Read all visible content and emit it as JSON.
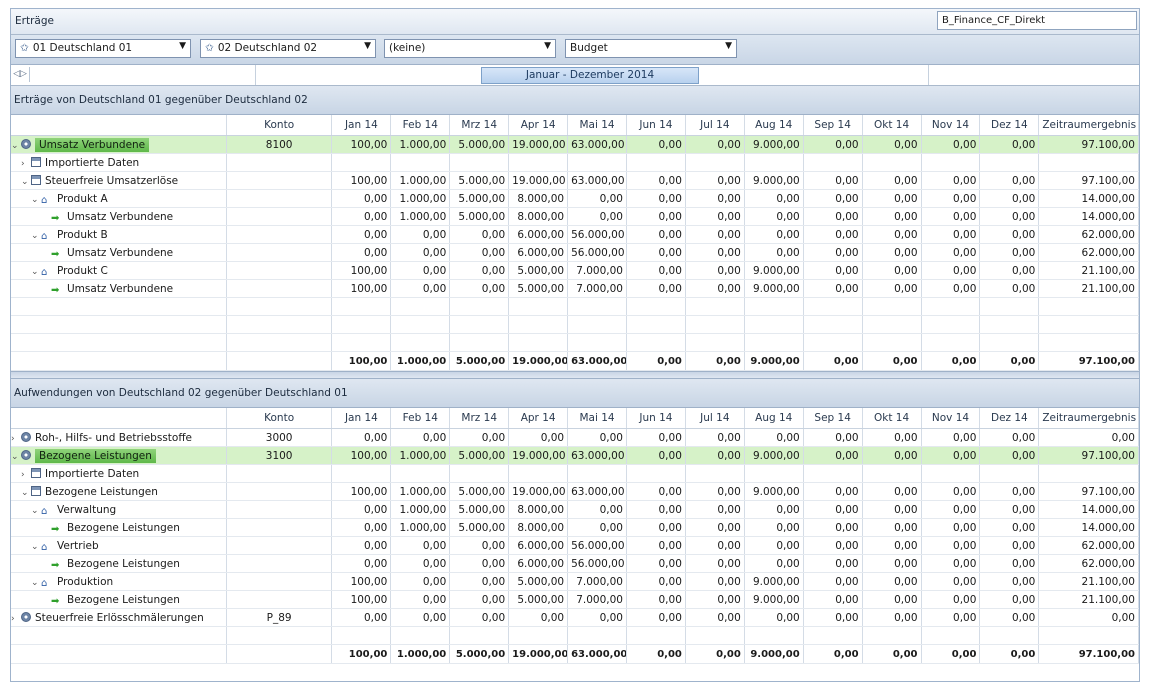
{
  "window": {
    "title": "Erträge",
    "right_combo": "B_Finance_CF_Direkt"
  },
  "filters": [
    {
      "label": "01 Deutschland 01",
      "star": true
    },
    {
      "label": "02 Deutschland 02",
      "star": true
    },
    {
      "label": "(keine)",
      "star": false
    },
    {
      "label": "Budget",
      "star": false
    }
  ],
  "period": {
    "range": "Januar - Dezember 2014"
  },
  "columns": [
    "",
    "Konto",
    "Jan 14",
    "Feb 14",
    "Mrz 14",
    "Apr 14",
    "Mai 14",
    "Jun 14",
    "Jul 14",
    "Aug 14",
    "Sep 14",
    "Okt 14",
    "Nov 14",
    "Dez 14",
    "Zeitraumergebnis"
  ],
  "sections": [
    {
      "title": "Erträge von Deutschland 01 gegenüber Deutschland 02",
      "rows": [
        {
          "level": 0,
          "exp": "v",
          "icon": "gear",
          "name": "Umsatz Verbundene",
          "konto": "8100",
          "hl": true,
          "v": [
            "100,00",
            "1.000,00",
            "5.000,00",
            "19.000,00",
            "63.000,00",
            "0,00",
            "0,00",
            "9.000,00",
            "0,00",
            "0,00",
            "0,00",
            "0,00",
            "97.100,00"
          ]
        },
        {
          "level": 1,
          "exp": ">",
          "icon": "table",
          "name": "Importierte Daten",
          "konto": "",
          "v": [
            "",
            "",
            "",
            "",
            "",
            "",
            "",
            "",
            "",
            "",
            "",
            "",
            ""
          ]
        },
        {
          "level": 1,
          "exp": "v",
          "icon": "table",
          "name": "Steuerfreie Umsatzerlöse",
          "konto": "",
          "v": [
            "100,00",
            "1.000,00",
            "5.000,00",
            "19.000,00",
            "63.000,00",
            "0,00",
            "0,00",
            "9.000,00",
            "0,00",
            "0,00",
            "0,00",
            "0,00",
            "97.100,00"
          ]
        },
        {
          "level": 2,
          "exp": "v",
          "icon": "house",
          "name": "Produkt A",
          "konto": "",
          "v": [
            "0,00",
            "1.000,00",
            "5.000,00",
            "8.000,00",
            "0,00",
            "0,00",
            "0,00",
            "0,00",
            "0,00",
            "0,00",
            "0,00",
            "0,00",
            "14.000,00"
          ]
        },
        {
          "level": 3,
          "exp": "",
          "icon": "arrow",
          "name": "Umsatz Verbundene",
          "konto": "",
          "v": [
            "0,00",
            "1.000,00",
            "5.000,00",
            "8.000,00",
            "0,00",
            "0,00",
            "0,00",
            "0,00",
            "0,00",
            "0,00",
            "0,00",
            "0,00",
            "14.000,00"
          ]
        },
        {
          "level": 2,
          "exp": "v",
          "icon": "house",
          "name": "Produkt B",
          "konto": "",
          "v": [
            "0,00",
            "0,00",
            "0,00",
            "6.000,00",
            "56.000,00",
            "0,00",
            "0,00",
            "0,00",
            "0,00",
            "0,00",
            "0,00",
            "0,00",
            "62.000,00"
          ]
        },
        {
          "level": 3,
          "exp": "",
          "icon": "arrow",
          "name": "Umsatz Verbundene",
          "konto": "",
          "v": [
            "0,00",
            "0,00",
            "0,00",
            "6.000,00",
            "56.000,00",
            "0,00",
            "0,00",
            "0,00",
            "0,00",
            "0,00",
            "0,00",
            "0,00",
            "62.000,00"
          ]
        },
        {
          "level": 2,
          "exp": "v",
          "icon": "house",
          "name": "Produkt C",
          "konto": "",
          "v": [
            "100,00",
            "0,00",
            "0,00",
            "5.000,00",
            "7.000,00",
            "0,00",
            "0,00",
            "9.000,00",
            "0,00",
            "0,00",
            "0,00",
            "0,00",
            "21.100,00"
          ]
        },
        {
          "level": 3,
          "exp": "",
          "icon": "arrow",
          "name": "Umsatz Verbundene",
          "konto": "",
          "v": [
            "100,00",
            "0,00",
            "0,00",
            "5.000,00",
            "7.000,00",
            "0,00",
            "0,00",
            "9.000,00",
            "0,00",
            "0,00",
            "0,00",
            "0,00",
            "21.100,00"
          ]
        }
      ],
      "blank_rows": 3,
      "totals": [
        "100,00",
        "1.000,00",
        "5.000,00",
        "19.000,00",
        "63.000,00",
        "0,00",
        "0,00",
        "9.000,00",
        "0,00",
        "0,00",
        "0,00",
        "0,00",
        "97.100,00"
      ]
    },
    {
      "title": "Aufwendungen von Deutschland 02 gegenüber Deutschland 01",
      "rows": [
        {
          "level": 0,
          "exp": ">",
          "icon": "gear",
          "name": "Roh-, Hilfs- und Betriebsstoffe",
          "konto": "3000",
          "v": [
            "0,00",
            "0,00",
            "0,00",
            "0,00",
            "0,00",
            "0,00",
            "0,00",
            "0,00",
            "0,00",
            "0,00",
            "0,00",
            "0,00",
            "0,00"
          ]
        },
        {
          "level": 0,
          "exp": "v",
          "icon": "gear",
          "name": "Bezogene Leistungen",
          "konto": "3100",
          "hl": true,
          "v": [
            "100,00",
            "1.000,00",
            "5.000,00",
            "19.000,00",
            "63.000,00",
            "0,00",
            "0,00",
            "9.000,00",
            "0,00",
            "0,00",
            "0,00",
            "0,00",
            "97.100,00"
          ]
        },
        {
          "level": 1,
          "exp": ">",
          "icon": "table",
          "name": "Importierte Daten",
          "konto": "",
          "v": [
            "",
            "",
            "",
            "",
            "",
            "",
            "",
            "",
            "",
            "",
            "",
            "",
            ""
          ]
        },
        {
          "level": 1,
          "exp": "v",
          "icon": "table",
          "name": "Bezogene Leistungen",
          "konto": "",
          "v": [
            "100,00",
            "1.000,00",
            "5.000,00",
            "19.000,00",
            "63.000,00",
            "0,00",
            "0,00",
            "9.000,00",
            "0,00",
            "0,00",
            "0,00",
            "0,00",
            "97.100,00"
          ]
        },
        {
          "level": 2,
          "exp": "v",
          "icon": "house",
          "name": "Verwaltung",
          "konto": "",
          "v": [
            "0,00",
            "1.000,00",
            "5.000,00",
            "8.000,00",
            "0,00",
            "0,00",
            "0,00",
            "0,00",
            "0,00",
            "0,00",
            "0,00",
            "0,00",
            "14.000,00"
          ]
        },
        {
          "level": 3,
          "exp": "",
          "icon": "arrow",
          "name": "Bezogene Leistungen",
          "konto": "",
          "v": [
            "0,00",
            "1.000,00",
            "5.000,00",
            "8.000,00",
            "0,00",
            "0,00",
            "0,00",
            "0,00",
            "0,00",
            "0,00",
            "0,00",
            "0,00",
            "14.000,00"
          ]
        },
        {
          "level": 2,
          "exp": "v",
          "icon": "house",
          "name": "Vertrieb",
          "konto": "",
          "v": [
            "0,00",
            "0,00",
            "0,00",
            "6.000,00",
            "56.000,00",
            "0,00",
            "0,00",
            "0,00",
            "0,00",
            "0,00",
            "0,00",
            "0,00",
            "62.000,00"
          ]
        },
        {
          "level": 3,
          "exp": "",
          "icon": "arrow",
          "name": "Bezogene Leistungen",
          "konto": "",
          "v": [
            "0,00",
            "0,00",
            "0,00",
            "6.000,00",
            "56.000,00",
            "0,00",
            "0,00",
            "0,00",
            "0,00",
            "0,00",
            "0,00",
            "0,00",
            "62.000,00"
          ]
        },
        {
          "level": 2,
          "exp": "v",
          "icon": "house",
          "name": "Produktion",
          "konto": "",
          "v": [
            "100,00",
            "0,00",
            "0,00",
            "5.000,00",
            "7.000,00",
            "0,00",
            "0,00",
            "9.000,00",
            "0,00",
            "0,00",
            "0,00",
            "0,00",
            "21.100,00"
          ]
        },
        {
          "level": 3,
          "exp": "",
          "icon": "arrow",
          "name": "Bezogene Leistungen",
          "konto": "",
          "v": [
            "100,00",
            "0,00",
            "0,00",
            "5.000,00",
            "7.000,00",
            "0,00",
            "0,00",
            "9.000,00",
            "0,00",
            "0,00",
            "0,00",
            "0,00",
            "21.100,00"
          ]
        },
        {
          "level": 0,
          "exp": ">",
          "icon": "gear",
          "name": "Steuerfreie Erlösschmälerungen",
          "konto": "P_89",
          "v": [
            "0,00",
            "0,00",
            "0,00",
            "0,00",
            "0,00",
            "0,00",
            "0,00",
            "0,00",
            "0,00",
            "0,00",
            "0,00",
            "0,00",
            "0,00"
          ]
        }
      ],
      "blank_rows": 1,
      "totals": [
        "100,00",
        "1.000,00",
        "5.000,00",
        "19.000,00",
        "63.000,00",
        "0,00",
        "0,00",
        "9.000,00",
        "0,00",
        "0,00",
        "0,00",
        "0,00",
        "97.100,00"
      ]
    }
  ]
}
